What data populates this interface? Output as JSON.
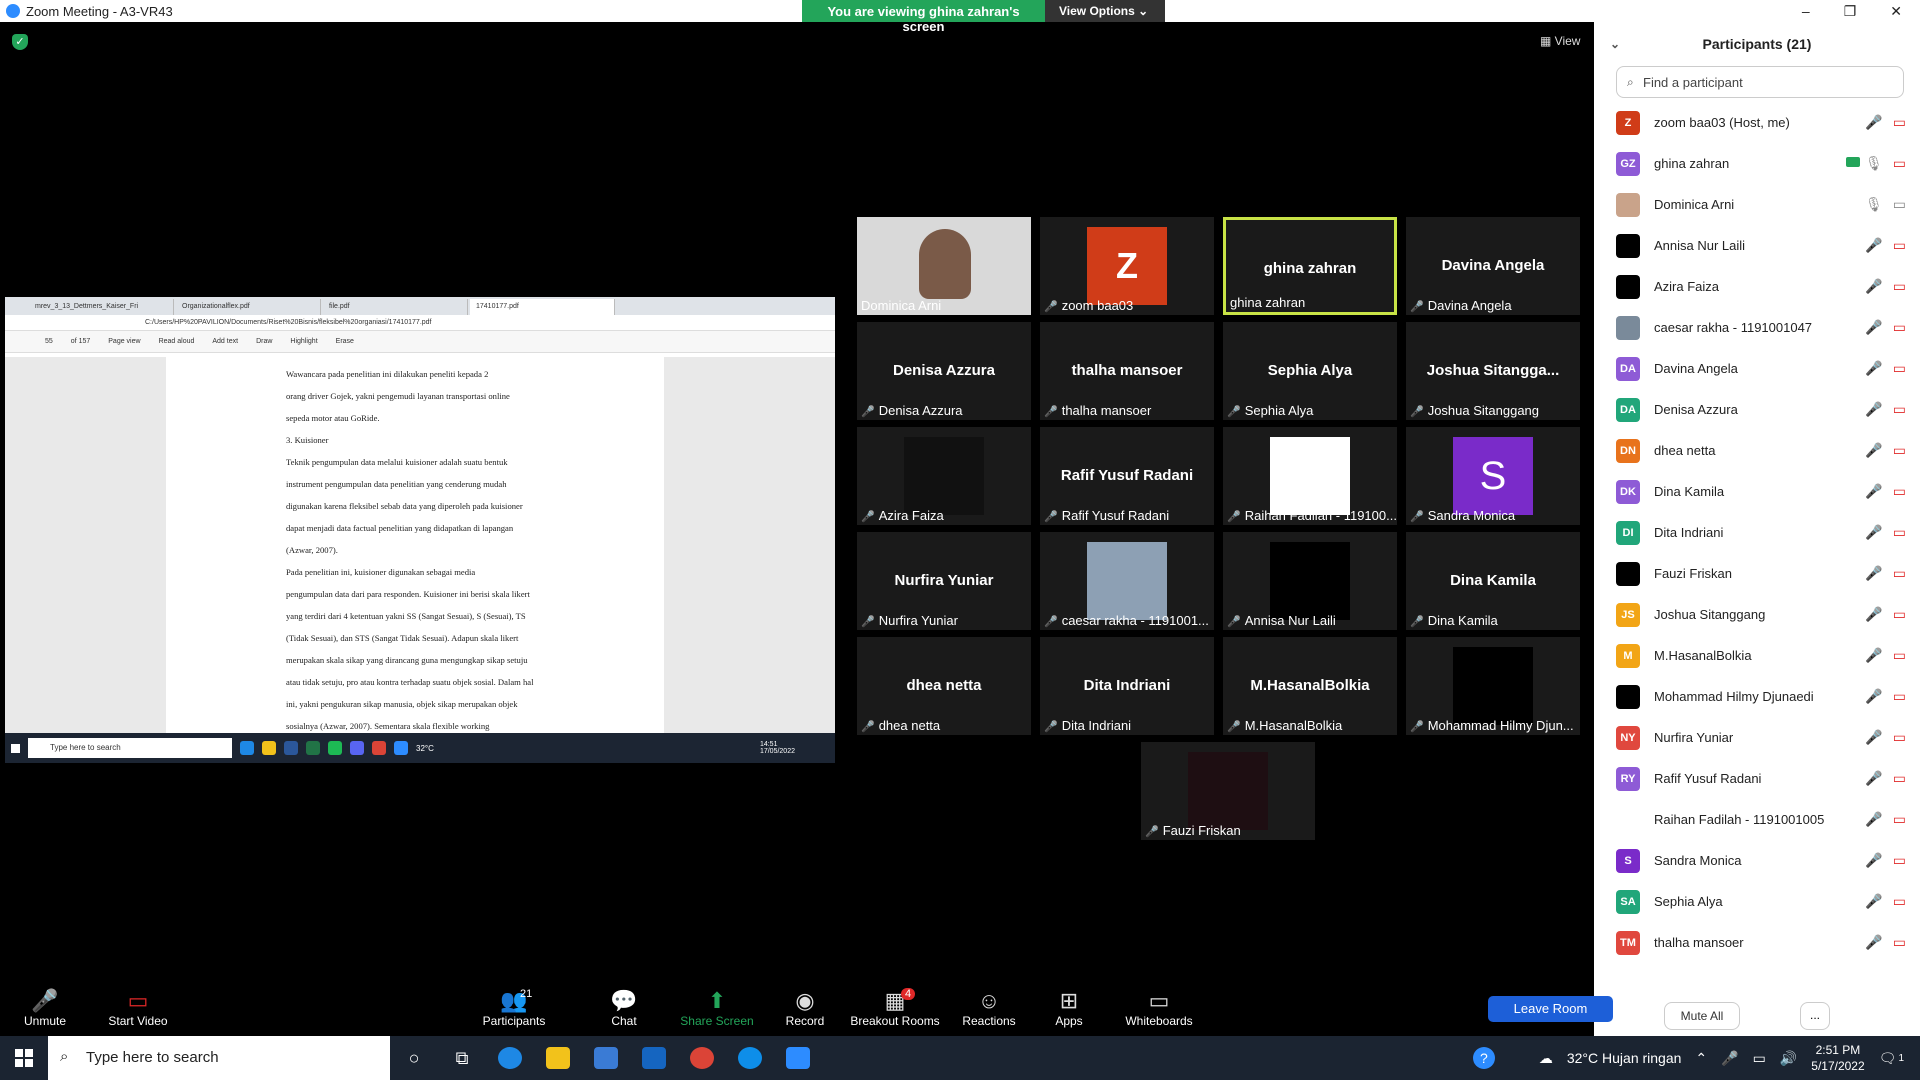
{
  "window": {
    "title": "Zoom Meeting - A3-VR43",
    "controls": [
      "–",
      "❐",
      "✕"
    ]
  },
  "banner": {
    "viewing": "You are viewing ghina zahran's screen",
    "options": "View Options ⌄"
  },
  "view_button": "▦ View",
  "shared_screen": {
    "tabs": [
      "mrev_3_13_Dettmers_Kaiser_Fri",
      "Organizationalflex.pdf",
      "file.pdf",
      "17410177.pdf"
    ],
    "address": "C:/Users/HP%20PAVILION/Documents/Riset%20Bisnis/fleksibel%20organiasi/17410177.pdf",
    "page_num": "55",
    "page_total": "of 157",
    "tools": [
      "Page view",
      "Read aloud",
      "Add text",
      "Draw",
      "Highlight",
      "Erase"
    ],
    "doc_lines": [
      "Wawancara pada penelitian ini dilakukan peneliti kepada 2",
      "orang driver Gojek, yakni pengemudi layanan transportasi online",
      "sepeda motor atau GoRide.",
      "3.   Kuisioner",
      "Teknik pengumpulan data melalui kuisioner adalah suatu bentuk",
      "instrument pengumpulan data penelitian yang cenderung mudah",
      "digunakan karena fleksibel sebab data yang diperoleh pada kuisioner",
      "dapat menjadi data factual penelitian yang didapatkan di lapangan",
      "(Azwar, 2007).",
      "Pada penelitian ini, kuisioner digunakan sebagai media",
      "pengumpulan data dari para responden. Kuisioner ini berisi skala likert",
      "yang terdiri dari 4 ketentuan yakni SS (Sangat Sesuai), S (Sesuai), TS",
      "(Tidak Sesuai), dan STS (Sangat Tidak Sesuai). Adapun skala likert",
      "merupakan skala sikap yang dirancang guna mengungkap sikap setuju",
      "atau tidak setuju, pro atau kontra terhadap suatu objek sosial. Dalam hal",
      "ini, yakni pengukuran sikap manusia, objek sikap merupakan objek",
      "sosialnya (Azwar, 2007). Sementara skala flexible working"
    ],
    "mini_taskbar": {
      "search": "Type here to search",
      "temp": "32°C",
      "time": "14:51",
      "date": "17/05/2022"
    }
  },
  "tiles": [
    {
      "name": "Dominica Arni",
      "big": "",
      "kind": "video",
      "muted": false
    },
    {
      "name": "zoom baa03",
      "big": "",
      "kind": "avatar-z",
      "avatar": "Z",
      "muted": true
    },
    {
      "name": "ghina zahran",
      "big": "ghina zahran",
      "kind": "name",
      "muted": false,
      "active": true
    },
    {
      "name": "Davina Angela",
      "big": "Davina Angela",
      "kind": "name",
      "muted": true
    },
    {
      "name": "Denisa Azzura",
      "big": "Denisa Azzura",
      "kind": "name",
      "muted": true
    },
    {
      "name": "thalha mansoer",
      "big": "thalha mansoer",
      "kind": "name",
      "muted": true
    },
    {
      "name": "Sephia Alya",
      "big": "Sephia Alya",
      "kind": "name",
      "muted": true
    },
    {
      "name": "Joshua Sitanggang",
      "big": "Joshua  Sitangga...",
      "kind": "name",
      "muted": true
    },
    {
      "name": "Azira Faiza",
      "big": "",
      "kind": "dark",
      "muted": true
    },
    {
      "name": "Rafif Yusuf Radani",
      "big": "Rafif Yusuf Radani",
      "kind": "name",
      "muted": true
    },
    {
      "name": "Raihan Fadilah - 119100...",
      "big": "",
      "kind": "white",
      "muted": true
    },
    {
      "name": "Sandra Monica",
      "big": "",
      "kind": "avatar-s",
      "avatar": "S",
      "muted": true
    },
    {
      "name": "Nurfira Yuniar",
      "big": "Nurfira Yuniar",
      "kind": "name",
      "muted": true
    },
    {
      "name": "caesar rakha - 1191001...",
      "big": "",
      "kind": "photo",
      "muted": true
    },
    {
      "name": "Annisa Nur Laili",
      "big": "",
      "kind": "black",
      "muted": true
    },
    {
      "name": "Dina Kamila",
      "big": "Dina Kamila",
      "kind": "name",
      "muted": true
    },
    {
      "name": "dhea netta",
      "big": "dhea netta",
      "kind": "name",
      "muted": true
    },
    {
      "name": "Dita Indriani",
      "big": "Dita Indriani",
      "kind": "name",
      "muted": true
    },
    {
      "name": "M.HasanalBolkia",
      "big": "M.HasanalBolkia",
      "kind": "name",
      "muted": true
    },
    {
      "name": "Mohammad Hilmy Djun...",
      "big": "",
      "kind": "black",
      "muted": true
    },
    {
      "name": "Fauzi Friskan",
      "big": "",
      "kind": "darkred",
      "muted": true
    }
  ],
  "participants": {
    "title": "Participants (21)",
    "search_placeholder": "Find a participant",
    "list": [
      {
        "initials": "Z",
        "color": "#d03c18",
        "name": "zoom baa03 (Host, me)",
        "mic": "muted"
      },
      {
        "initials": "GZ",
        "color": "#8e5bd6",
        "name": "ghina zahran",
        "mic": "on",
        "share": true
      },
      {
        "initials": "",
        "color": "#c9a38a",
        "name": "Dominica Arni",
        "mic": "on",
        "video": true
      },
      {
        "initials": "",
        "color": "#000000",
        "name": "Annisa Nur Laili",
        "mic": "muted"
      },
      {
        "initials": "",
        "color": "#000000",
        "name": "Azira Faiza",
        "mic": "muted"
      },
      {
        "initials": "",
        "color": "#7a8a9a",
        "name": "caesar rakha - 1191001047",
        "mic": "muted"
      },
      {
        "initials": "DA",
        "color": "#8e5bd6",
        "name": "Davina Angela",
        "mic": "muted"
      },
      {
        "initials": "DA",
        "color": "#21a67a",
        "name": "Denisa Azzura",
        "mic": "muted"
      },
      {
        "initials": "DN",
        "color": "#e8731c",
        "name": "dhea netta",
        "mic": "muted"
      },
      {
        "initials": "DK",
        "color": "#8e5bd6",
        "name": "Dina Kamila",
        "mic": "muted"
      },
      {
        "initials": "DI",
        "color": "#21a67a",
        "name": "Dita Indriani",
        "mic": "muted"
      },
      {
        "initials": "",
        "color": "#000000",
        "name": "Fauzi Friskan",
        "mic": "muted"
      },
      {
        "initials": "JS",
        "color": "#f2a516",
        "name": "Joshua Sitanggang",
        "mic": "muted"
      },
      {
        "initials": "M",
        "color": "#f2a516",
        "name": "M.HasanalBolkia",
        "mic": "muted"
      },
      {
        "initials": "",
        "color": "#000000",
        "name": "Mohammad Hilmy Djunaedi",
        "mic": "muted"
      },
      {
        "initials": "NY",
        "color": "#e0483e",
        "name": "Nurfira Yuniar",
        "mic": "muted"
      },
      {
        "initials": "RY",
        "color": "#8e5bd6",
        "name": "Rafif Yusuf Radani",
        "mic": "muted"
      },
      {
        "initials": "",
        "color": "#ffffff",
        "name": "Raihan Fadilah - 1191001005",
        "mic": "muted"
      },
      {
        "initials": "S",
        "color": "#7a2bc9",
        "name": "Sandra Monica",
        "mic": "muted"
      },
      {
        "initials": "SA",
        "color": "#21a67a",
        "name": "Sephia Alya",
        "mic": "muted"
      },
      {
        "initials": "TM",
        "color": "#e0483e",
        "name": "thalha mansoer",
        "mic": "muted"
      }
    ],
    "mute_all": "Mute All",
    "more": "..."
  },
  "controls": {
    "unmute": "Unmute",
    "start_video": "Start Video",
    "participants": "Participants",
    "participants_count": "21",
    "chat": "Chat",
    "share_screen": "Share Screen",
    "record": "Record",
    "breakout": "Breakout Rooms",
    "breakout_count": "4",
    "reactions": "Reactions",
    "apps": "Apps",
    "whiteboards": "Whiteboards",
    "leave": "Leave Room"
  },
  "taskbar": {
    "search": "Type here to search",
    "weather": "32°C  Hujan ringan",
    "time": "2:51 PM",
    "date": "5/17/2022",
    "notif_count": "1"
  },
  "colors": {
    "accent": "#2d8cff",
    "green": "#23a55a",
    "muted_red": "#e02828",
    "active_border": "#c8e346",
    "leave_blue": "#1d5fd8"
  }
}
